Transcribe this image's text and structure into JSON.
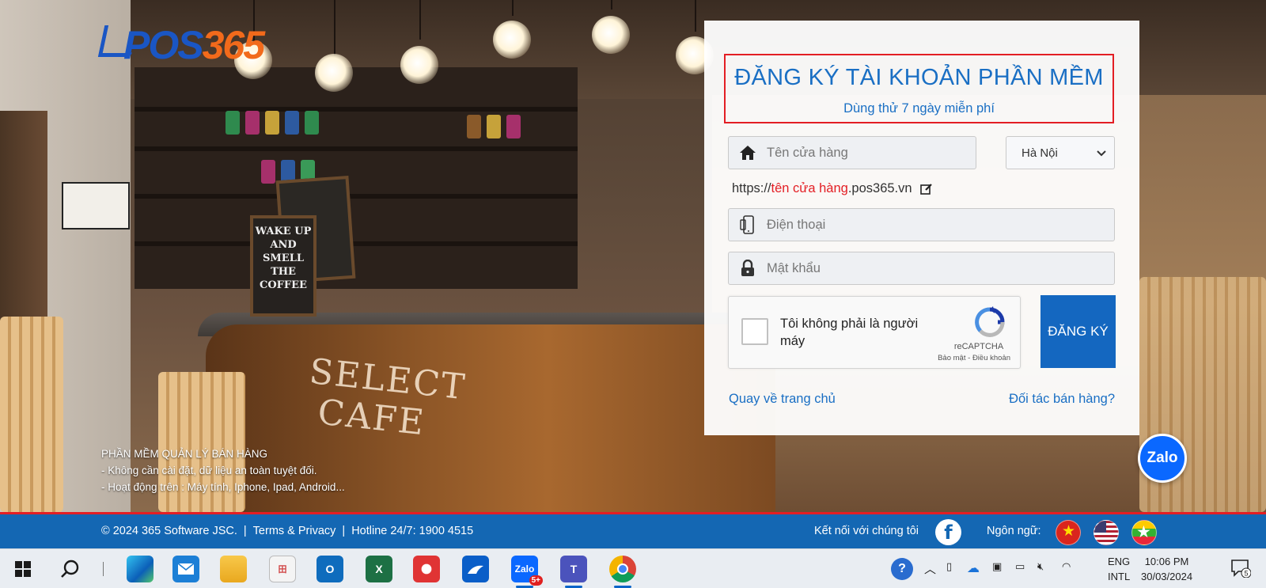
{
  "brand": {
    "logo_left": "POS",
    "logo_right": "365"
  },
  "promo": {
    "line1": "PHẦN MỀM QUẢN LÝ BÁN HÀNG",
    "line2": "- Không cần cài đặt, dữ liệu an toàn tuyệt đối.",
    "line3": "- Hoạt động trên : Máy tính, Iphone, Ipad, Android..."
  },
  "form": {
    "title": "ĐĂNG KÝ TÀI KHOẢN PHẦN MỀM",
    "subtitle": "Dùng thử 7 ngày miễn phí",
    "store_name": {
      "placeholder": "Tên cửa hàng",
      "icon": "home-icon",
      "value": ""
    },
    "city": {
      "selected": "Hà Nội"
    },
    "url": {
      "prefix": "https://",
      "store": "tên cửa hàng",
      "suffix": ".pos365.vn",
      "icon": "edit-icon"
    },
    "phone": {
      "placeholder": "Điện thoại",
      "icon": "phone-icon",
      "value": ""
    },
    "password": {
      "placeholder": "Mật khẩu",
      "icon": "lock-icon",
      "value": ""
    },
    "captcha": {
      "label": "Tôi không phải là người máy",
      "brand": "reCAPTCHA",
      "privacy": "Bảo mật",
      "separator": " - ",
      "terms": "Điều khoản",
      "checked": false
    },
    "submit_label": "ĐĂNG KÝ",
    "link_home": "Quay về trang chủ",
    "link_partner": "Đối tác bán hàng?"
  },
  "zalo": {
    "label": "Zalo"
  },
  "footer": {
    "copyright": "© 2024 365 Software JSC.",
    "sep1": "|",
    "terms": "Terms & Privacy",
    "sep2": "|",
    "hotline": "Hotline 24/7: 1900 4515",
    "connect": "Kết nối với chúng tôi",
    "facebook_icon": "facebook-icon",
    "language_label": "Ngôn ngữ:",
    "languages": [
      "vietnam-flag",
      "usa-flag",
      "myanmar-flag"
    ]
  },
  "taskbar": {
    "apps": [
      "windows-start",
      "search",
      "edge",
      "mail",
      "file-explorer",
      "app-grid",
      "outlook",
      "excel",
      "chrome-red",
      "app-bird",
      "zalo",
      "teams",
      "chrome"
    ],
    "zalo_badge": "5+",
    "tray": {
      "lang_line1": "ENG",
      "lang_line2": "INTL",
      "time": "10:06 PM",
      "date": "30/03/2024",
      "notification_count": "5"
    }
  },
  "colors": {
    "accent": "#1a6fc4",
    "footer": "#1467b3",
    "highlight": "#e31e24",
    "button": "#1467c0"
  }
}
